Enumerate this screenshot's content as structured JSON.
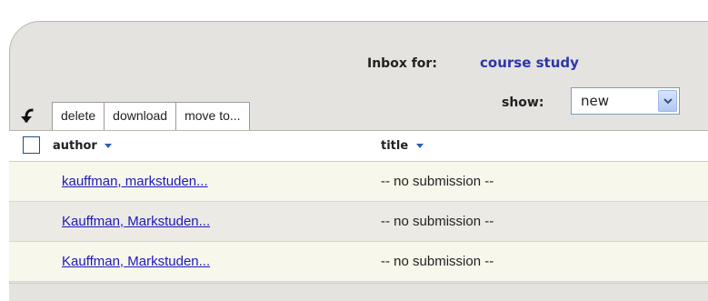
{
  "header": {
    "inbox_label": "Inbox for:",
    "inbox_name": "course study"
  },
  "filter": {
    "show_label": "show:",
    "selected": "new"
  },
  "toolbar": {
    "back_icon": "curved-arrow-down-left-icon",
    "buttons": [
      "delete",
      "download",
      "move to..."
    ]
  },
  "table": {
    "columns": [
      "author",
      "title"
    ],
    "rows": [
      {
        "author": "kauffman, markstuden...",
        "title": "-- no submission --"
      },
      {
        "author": "Kauffman, Markstuden...",
        "title": "-- no submission --"
      },
      {
        "author": "Kauffman, Markstuden...",
        "title": "-- no submission --"
      }
    ]
  },
  "colors": {
    "link": "#1d1ab6",
    "course_name": "#2c37a8",
    "row_odd": "#f8f7ec",
    "row_even": "#ebeae4",
    "panel": "#e5e3df"
  }
}
